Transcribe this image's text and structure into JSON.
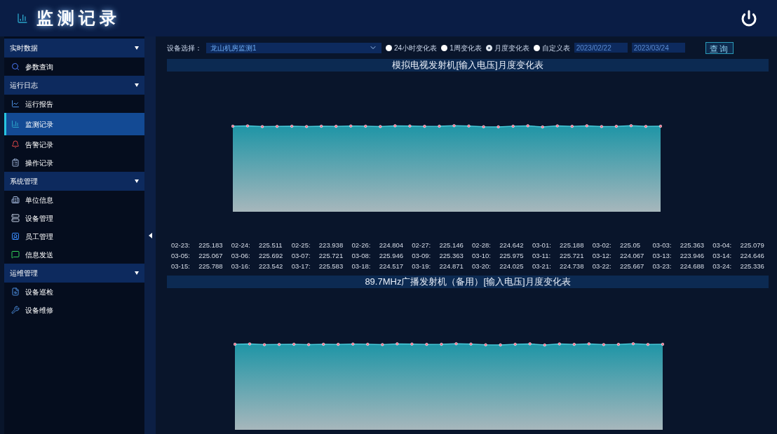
{
  "header": {
    "title": "监测记录"
  },
  "sidebar": {
    "groups": [
      {
        "label": "实时数据",
        "expanded": true,
        "items": [
          {
            "label": "参数查询",
            "selected": false
          }
        ]
      },
      {
        "label": "运行日志",
        "expanded": true,
        "items": [
          {
            "label": "运行报告",
            "selected": false
          },
          {
            "label": "监测记录",
            "selected": true
          },
          {
            "label": "告警记录",
            "selected": false
          },
          {
            "label": "操作记录",
            "selected": false
          }
        ]
      },
      {
        "label": "系统管理",
        "expanded": true,
        "items": [
          {
            "label": "单位信息",
            "selected": false
          },
          {
            "label": "设备管理",
            "selected": false
          },
          {
            "label": "员工管理",
            "selected": false
          },
          {
            "label": "信息发送",
            "selected": false
          }
        ]
      },
      {
        "label": "运维管理",
        "expanded": true,
        "items": [
          {
            "label": "设备巡检",
            "selected": false
          },
          {
            "label": "设备维修",
            "selected": false
          }
        ]
      }
    ]
  },
  "toolbar": {
    "device_label": "设备选择：",
    "device": "龙山机房监测1",
    "ranges": [
      {
        "label": "24小时变化表",
        "selected": false
      },
      {
        "label": "1周变化表",
        "selected": false
      },
      {
        "label": "月度变化表",
        "selected": true
      },
      {
        "label": "自定义表",
        "selected": false
      }
    ],
    "start_date": "2023/02/22",
    "end_date": "2023/03/24",
    "query_button": "查询"
  },
  "charts": [
    {
      "title": "模拟电视发射机[输入电压]月度变化表",
      "readings": [
        {
          "date": "02-23:",
          "value": "225.183"
        },
        {
          "date": "02-24:",
          "value": "225.511"
        },
        {
          "date": "02-25:",
          "value": "223.938"
        },
        {
          "date": "02-26:",
          "value": "224.804"
        },
        {
          "date": "02-27:",
          "value": "225.146"
        },
        {
          "date": "02-28:",
          "value": "224.642"
        },
        {
          "date": "03-01:",
          "value": "225.188"
        },
        {
          "date": "03-02:",
          "value": "225.05"
        },
        {
          "date": "03-03:",
          "value": "225.363"
        },
        {
          "date": "03-04:",
          "value": "225.079"
        },
        {
          "date": "03-05:",
          "value": "225.067"
        },
        {
          "date": "03-06:",
          "value": "225.692"
        },
        {
          "date": "03-07:",
          "value": "225.721"
        },
        {
          "date": "03-08:",
          "value": "225.946"
        },
        {
          "date": "03-09:",
          "value": "225.363"
        },
        {
          "date": "03-10:",
          "value": "225.975"
        },
        {
          "date": "03-11:",
          "value": "225.721"
        },
        {
          "date": "03-12:",
          "value": "224.067"
        },
        {
          "date": "03-13:",
          "value": "223.946"
        },
        {
          "date": "03-14:",
          "value": "224.646"
        },
        {
          "date": "03-15:",
          "value": "225.788"
        },
        {
          "date": "03-16:",
          "value": "223.542"
        },
        {
          "date": "03-17:",
          "value": "225.583"
        },
        {
          "date": "03-18:",
          "value": "224.517"
        },
        {
          "date": "03-19:",
          "value": "224.871"
        },
        {
          "date": "03-20:",
          "value": "224.025"
        },
        {
          "date": "03-21:",
          "value": "224.738"
        },
        {
          "date": "03-22:",
          "value": "225.667"
        },
        {
          "date": "03-23:",
          "value": "224.688"
        },
        {
          "date": "03-24:",
          "value": "225.336"
        }
      ]
    },
    {
      "title": "89.7MHz广播发射机（备用）[输入电压]月度变化表"
    }
  ]
}
